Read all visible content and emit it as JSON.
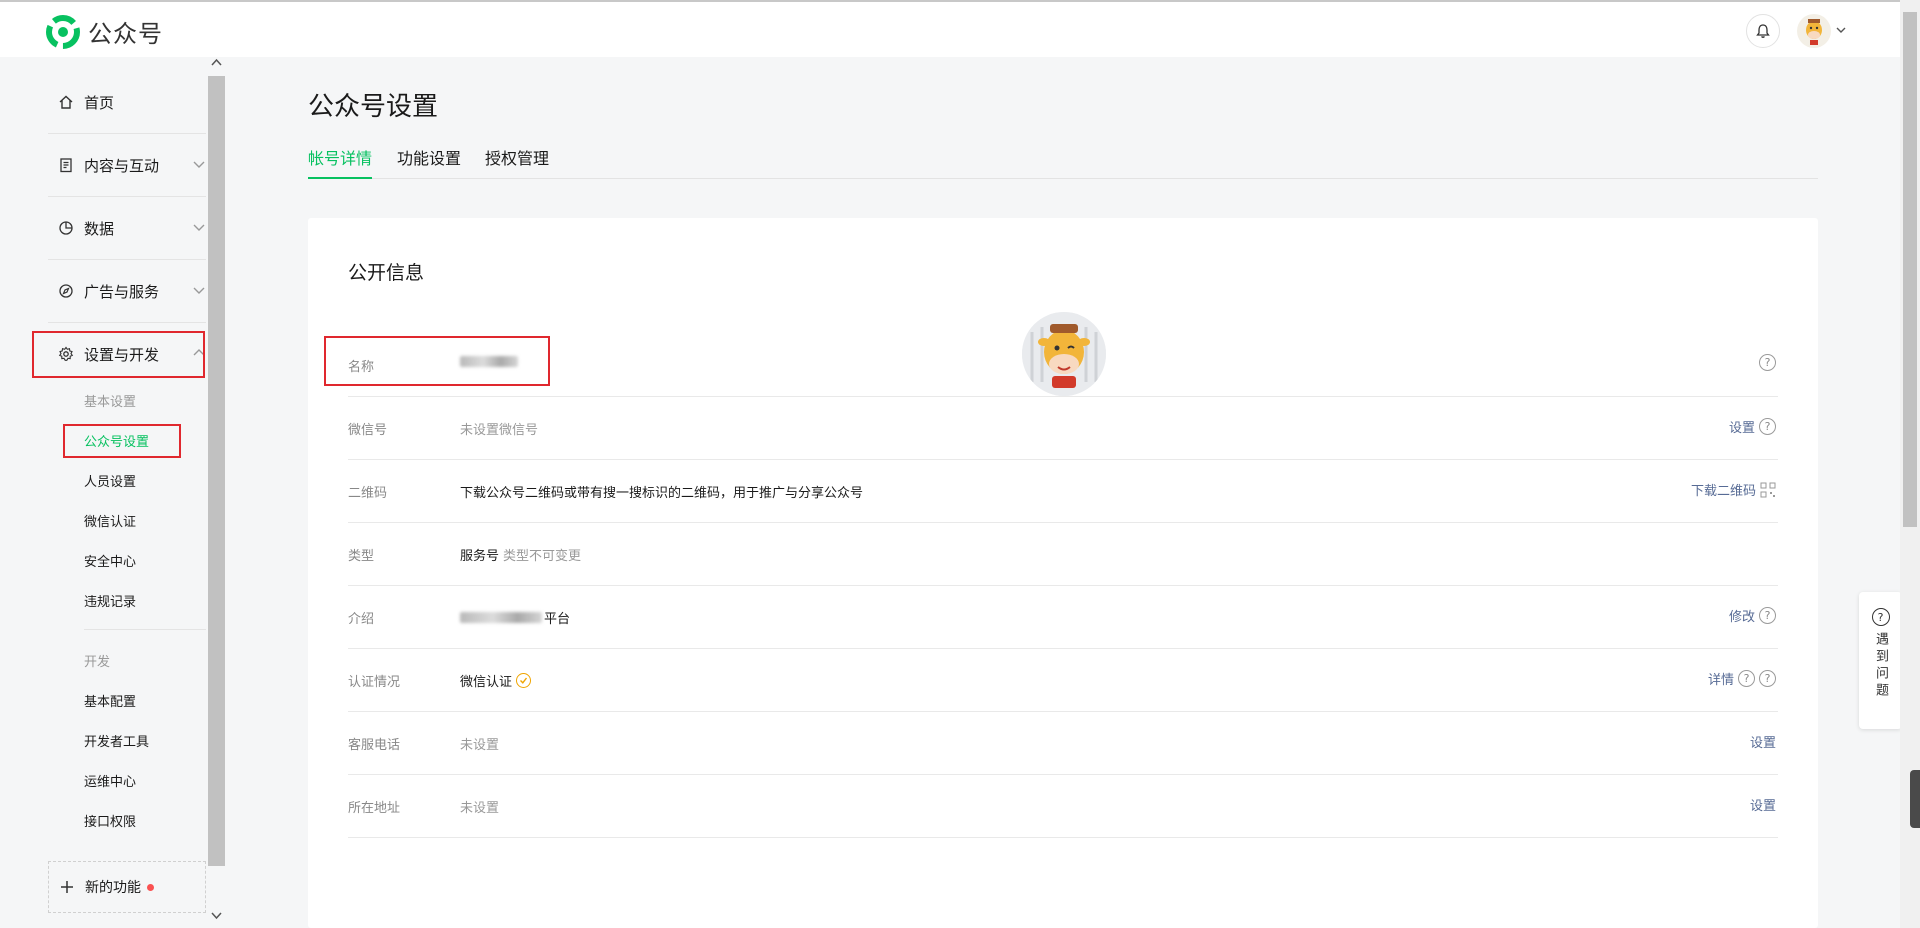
{
  "brand": {
    "name": "公众号",
    "color": "#07c160"
  },
  "header": {
    "bell_icon": "bell-icon",
    "avatar_icon": "cartoon-cow-avatar"
  },
  "sidebar": {
    "main": [
      {
        "label": "首页",
        "icon": "home-icon"
      },
      {
        "label": "内容与互动",
        "icon": "document-icon"
      },
      {
        "label": "数据",
        "icon": "pie-chart-icon"
      },
      {
        "label": "广告与服务",
        "icon": "compass-icon"
      },
      {
        "label": "设置与开发",
        "icon": "gear-icon"
      }
    ],
    "group1_head": "基本设置",
    "group1": [
      "公众号设置",
      "人员设置",
      "微信认证",
      "安全中心",
      "违规记录"
    ],
    "group2_head": "开发",
    "group2": [
      "基本配置",
      "开发者工具",
      "运维中心",
      "接口权限"
    ],
    "new_feature": "新的功能",
    "active_color": "#07c160"
  },
  "page": {
    "title": "公众号设置",
    "tabs": [
      "帐号详情",
      "功能设置",
      "授权管理"
    ]
  },
  "card": {
    "title": "公开信息",
    "rows": [
      {
        "key": "名称",
        "value": "",
        "value_note": "",
        "action": "",
        "help": true
      },
      {
        "key": "微信号",
        "value": "",
        "value_note": "未设置微信号",
        "action": "设置",
        "help": true
      },
      {
        "key": "二维码",
        "value": "下载公众号二维码或带有搜一搜标识的二维码，用于推广与分享公众号",
        "value_note": "",
        "action": "下载二维码",
        "help": false
      },
      {
        "key": "类型",
        "value": "服务号",
        "value_note": "类型不可变更",
        "action": "",
        "help": false
      },
      {
        "key": "介绍",
        "value": "平台",
        "value_note": "",
        "action": "修改",
        "help": true
      },
      {
        "key": "认证情况",
        "value": "微信认证",
        "value_note": "",
        "action": "详情",
        "help": true
      },
      {
        "key": "客服电话",
        "value": "",
        "value_note": "未设置",
        "action": "设置",
        "help": false
      },
      {
        "key": "所在地址",
        "value": "",
        "value_note": "未设置",
        "action": "设置",
        "help": false
      }
    ],
    "link_color": "#576b95"
  },
  "help_float": {
    "label": "遇到问题"
  }
}
